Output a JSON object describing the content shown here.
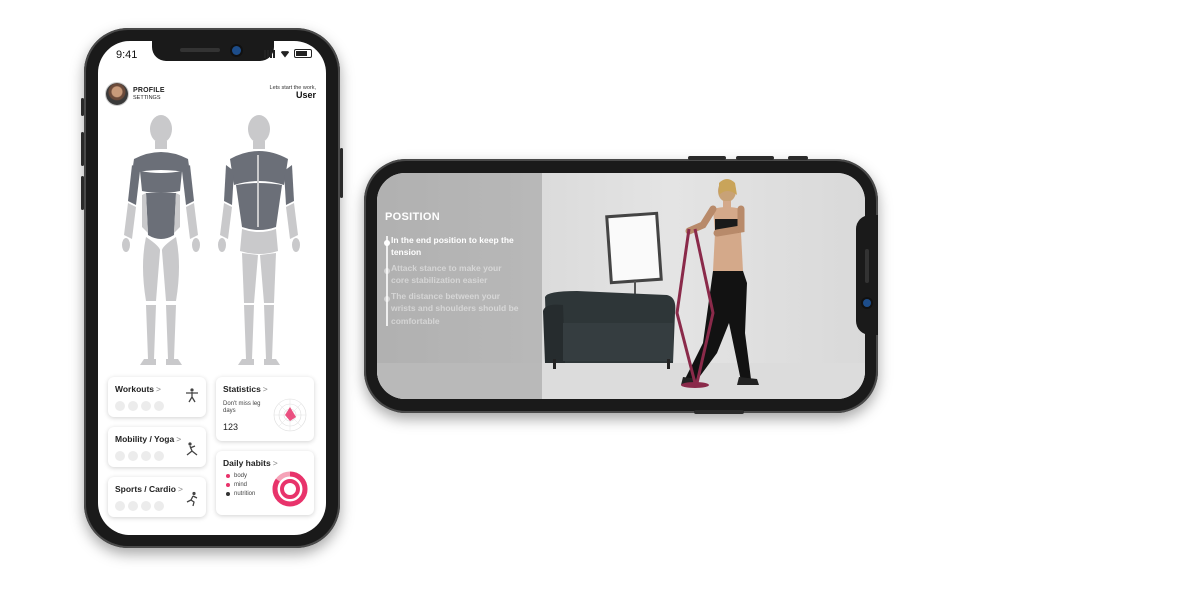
{
  "portrait": {
    "status": {
      "time": "9:41"
    },
    "profile": {
      "title": "PROFILE",
      "subtitle": "SETTINGS"
    },
    "greeting": {
      "line": "Lets start the work,",
      "user": "User"
    },
    "cards": {
      "workouts": {
        "title": "Workouts",
        "chevron": ">"
      },
      "mobility": {
        "title": "Mobility / Yoga",
        "chevron": ">"
      },
      "sports": {
        "title": "Sports / Cardio",
        "chevron": ">"
      },
      "statistics": {
        "title": "Statistics",
        "chevron": ">",
        "text": "Don't miss leg days",
        "value": "123"
      },
      "habits": {
        "title": "Daily habits",
        "chevron": ">",
        "legend": [
          {
            "label": "body",
            "color": "#e8336b"
          },
          {
            "label": "mind",
            "color": "#e8336b"
          },
          {
            "label": "nutrition",
            "color": "#333333"
          }
        ]
      }
    },
    "colors": {
      "accent": "#e8336b",
      "muscle_dark": "#6b6f78",
      "muscle_light": "#c9c9cb"
    }
  },
  "landscape": {
    "section_title": "POSITION",
    "items": [
      {
        "text": "In the end position to keep the tension",
        "state": "active"
      },
      {
        "text": "Attack stance to make your core stabilization easier",
        "state": "faded"
      },
      {
        "text": "The distance between your wrists and shoulders should be comfortable",
        "state": "faded"
      }
    ],
    "colors": {
      "band": "#8a2a4a",
      "sofa": "#2e3638"
    }
  }
}
